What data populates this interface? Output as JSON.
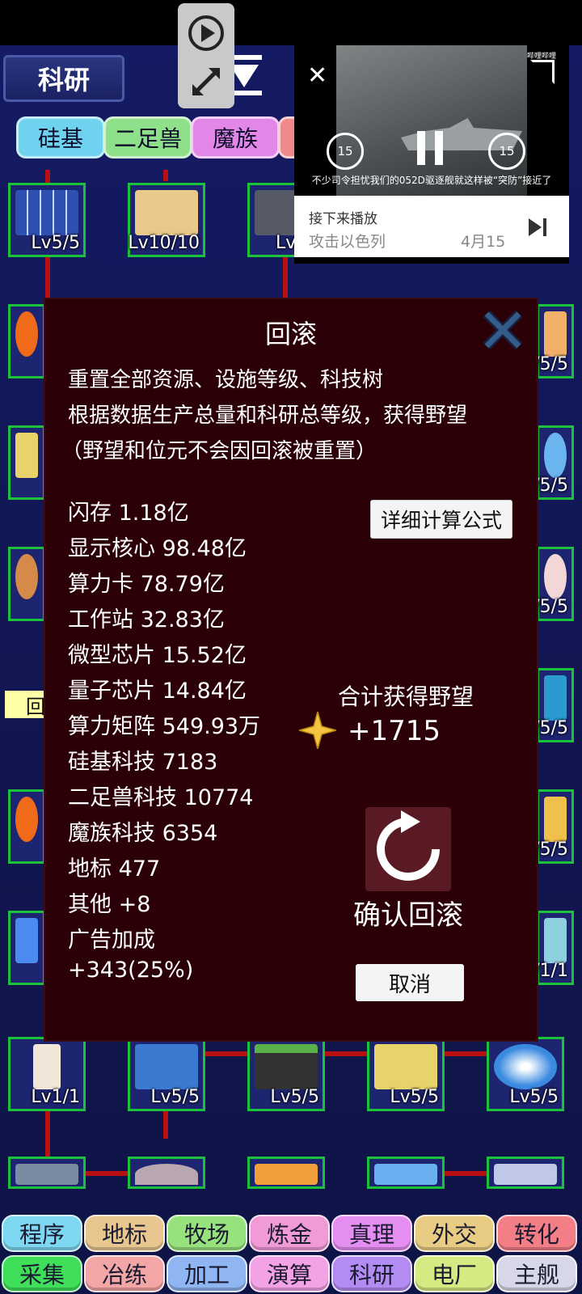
{
  "header": {
    "title": "科研"
  },
  "category_tabs": [
    {
      "label": "硅基",
      "color": "#6fd3ef"
    },
    {
      "label": "二足兽",
      "color": "#8fe08a"
    },
    {
      "label": "魔族",
      "color": "#e287e8"
    }
  ],
  "tiles_row1": [
    "Lv5/5",
    "Lv10/10",
    "Lv"
  ],
  "tiles_right": [
    "/5/5",
    "/5/5",
    "/5/5",
    "/5/5",
    "/5/5",
    "/1/1"
  ],
  "tiles_row_bottom": [
    "Lv1/1",
    "Lv5/5",
    "Lv5/5",
    "Lv5/5",
    "Lv5/5"
  ],
  "left_stub_label": "回",
  "video": {
    "caption": "不少司令担忧我们的052D驱逐舰就这样被“突防”接近了",
    "up_next_label": "接下来播放",
    "up_next_title": "攻击以色列",
    "up_next_date": "4月15",
    "rewind_label": "15",
    "forward_label": "15",
    "watermark": "哔哩哔哩"
  },
  "modal": {
    "title": "回滚",
    "desc": [
      "重置全部资源、设施等级、科技树",
      "根据数据生产总量和科研总等级，获得野望",
      "（野望和位元不会因回滚被重置）"
    ],
    "formula_button": "详细计算公式",
    "stats": [
      "闪存 1.18亿",
      "显示核心 98.48亿",
      "算力卡 78.79亿",
      "工作站 32.83亿",
      "微型芯片 15.52亿",
      "量子芯片 14.84亿",
      "算力矩阵 549.93万",
      "硅基科技 7183",
      "二足兽科技 10774",
      "魔族科技 6354",
      "地标 477",
      "其他 +8",
      "广告加成",
      "+343(25%)"
    ],
    "total_label": "合计获得野望",
    "total_value": "+1715",
    "confirm_label": "确认回滚",
    "cancel_label": "取消"
  },
  "nav_row1": [
    {
      "label": "程序",
      "color": "#7fd8f2"
    },
    {
      "label": "地标",
      "color": "#e7c690"
    },
    {
      "label": "牧场",
      "color": "#98e27e"
    },
    {
      "label": "炼金",
      "color": "#f09ad6"
    },
    {
      "label": "真理",
      "color": "#e38ef0"
    },
    {
      "label": "外交",
      "color": "#e9cc84"
    },
    {
      "label": "转化",
      "color": "#f37e86"
    }
  ],
  "nav_row2": [
    {
      "label": "采集",
      "color": "#3fdf5a"
    },
    {
      "label": "冶练",
      "color": "#f3a6a6"
    },
    {
      "label": "加工",
      "color": "#8fb5f3"
    },
    {
      "label": "演算",
      "color": "#f3a2e6"
    },
    {
      "label": "科研",
      "color": "#b38cf3"
    },
    {
      "label": "电厂",
      "color": "#d6ea84"
    },
    {
      "label": "主舰",
      "color": "#d7d7e8"
    }
  ]
}
